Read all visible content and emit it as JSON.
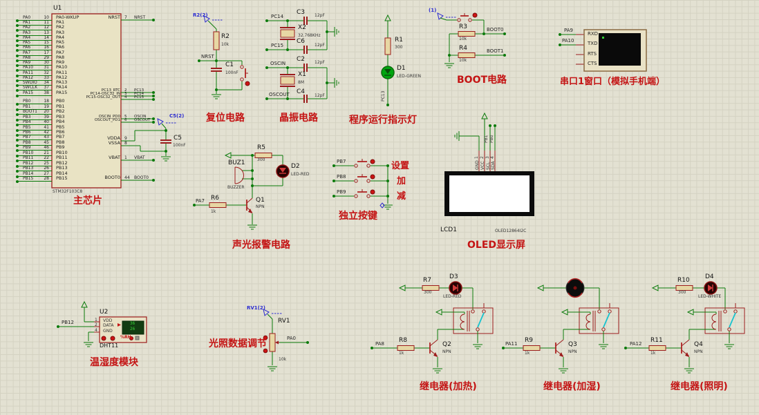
{
  "canvas": {
    "bg": "#e3e1d2",
    "grid": "#d4d2c2",
    "wire_color": "#0b7a0b",
    "part_color": "#9b1c1c",
    "accent_red": "#c41414",
    "accent_blue": "#2b2bd0"
  },
  "chip": {
    "ref": "U1",
    "part": "STM32F103C8",
    "caption": "主芯片",
    "pa_pins": [
      {
        "net": "PA0",
        "num": "10",
        "name": "PA0-WKUP"
      },
      {
        "net": "PA1",
        "num": "11",
        "name": "PA1"
      },
      {
        "net": "PA2",
        "num": "12",
        "name": "PA2"
      },
      {
        "net": "PA3",
        "num": "13",
        "name": "PA3"
      },
      {
        "net": "PA4",
        "num": "14",
        "name": "PA4"
      },
      {
        "net": "PA5",
        "num": "15",
        "name": "PA5"
      },
      {
        "net": "PA6",
        "num": "16",
        "name": "PA6"
      },
      {
        "net": "PA7",
        "num": "17",
        "name": "PA7"
      },
      {
        "net": "PA8",
        "num": "29",
        "name": "PA8"
      },
      {
        "net": "PA9",
        "num": "30",
        "name": "PA9"
      },
      {
        "net": "PA10",
        "num": "31",
        "name": "PA10"
      },
      {
        "net": "PA11",
        "num": "32",
        "name": "PA11"
      },
      {
        "net": "PA12",
        "num": "33",
        "name": "PA12"
      },
      {
        "net": "SWDIO",
        "num": "34",
        "name": "PA13"
      },
      {
        "net": "SWCLK",
        "num": "37",
        "name": "PA14"
      },
      {
        "net": "PA15",
        "num": "38",
        "name": "PA15"
      }
    ],
    "pb_pins": [
      {
        "net": "PB0",
        "num": "18",
        "name": "PB0"
      },
      {
        "net": "PB1",
        "num": "19",
        "name": "PB1"
      },
      {
        "net": "BOOT1",
        "num": "20",
        "name": "PB2"
      },
      {
        "net": "PB3",
        "num": "39",
        "name": "PB3"
      },
      {
        "net": "PB4",
        "num": "40",
        "name": "PB4"
      },
      {
        "net": "PB5",
        "num": "41",
        "name": "PB5"
      },
      {
        "net": "PB6",
        "num": "42",
        "name": "PB6"
      },
      {
        "net": "PB7",
        "num": "43",
        "name": "PB7"
      },
      {
        "net": "PB8",
        "num": "45",
        "name": "PB8"
      },
      {
        "net": "PB9",
        "num": "46",
        "name": "PB9"
      },
      {
        "net": "PB10",
        "num": "21",
        "name": "PB10"
      },
      {
        "net": "PB11",
        "num": "22",
        "name": "PB11"
      },
      {
        "net": "PB12",
        "num": "25",
        "name": "PB12"
      },
      {
        "net": "PB13",
        "num": "26",
        "name": "PB13"
      },
      {
        "net": "PB14",
        "num": "27",
        "name": "PB14"
      },
      {
        "net": "PB15",
        "num": "28",
        "name": "PB15"
      }
    ],
    "right_pins": [
      {
        "num": "7",
        "name": "NRST",
        "net": "NRST"
      },
      {
        "num": "2",
        "name": "PC13_RTC",
        "net": "PC13"
      },
      {
        "num": "3",
        "name": "PC14-OSC32_IN",
        "net": "PC14"
      },
      {
        "num": "4",
        "name": "PC15-OSC32_OUT",
        "net": "PC15"
      },
      {
        "num": "5",
        "name": "OSCIN_PD0",
        "net": "OSCIN"
      },
      {
        "num": "6",
        "name": "OSCOUT_PD1",
        "net": "OSCOUT"
      },
      {
        "num": "9",
        "name": "VDDA",
        "net": ""
      },
      {
        "num": "8",
        "name": "VSSA",
        "net": ""
      },
      {
        "num": "1",
        "name": "VBAT",
        "net": "VBAT"
      },
      {
        "num": "44",
        "name": "BOOT0",
        "net": "BOOT0"
      }
    ]
  },
  "reset": {
    "caption": "复位电路",
    "flag": "R2(2)",
    "r_ref": "R2",
    "r_val": "10k",
    "net": "NRST",
    "c_ref": "C1",
    "c_val": "100nF"
  },
  "crystal": {
    "caption": "晶振电路",
    "net_pc14": "PC14",
    "net_pc15": "PC15",
    "net_oscin": "OSCIN",
    "net_oscout": "OSCOUT",
    "c3": "C3",
    "c3_val": "12pF",
    "c6": "C6",
    "c6_val": "12pF",
    "c2": "C2",
    "c2_val": "12pF",
    "c4": "C4",
    "c4_val": "12pF",
    "x2": "X2",
    "x2_val": "32.768KHz",
    "x1": "X1",
    "x1_val": "8M"
  },
  "c5": {
    "flag": "C5(2)",
    "ref": "C5",
    "val": "100nF"
  },
  "runled": {
    "caption": "程序运行指示灯",
    "r_ref": "R1",
    "r_val": "300",
    "d_ref": "D1",
    "d_val": "LED-GREEN",
    "net": "PC13"
  },
  "boot": {
    "caption": "BOOT电路",
    "flag": "(1)",
    "r3_ref": "R3",
    "r3_val": "10k",
    "r4_ref": "R4",
    "r4_val": "10k",
    "net0": "BOOT0",
    "net1": "BOOT1"
  },
  "serial": {
    "caption": "串口1窗口（模拟手机端）",
    "net_rx": "PA9",
    "net_tx": "PA10",
    "pin_rxd": "RXD",
    "pin_txd": "TXD",
    "pin_rts": "RTS",
    "pin_cts": "CTS"
  },
  "alarm": {
    "caption": "声光报警电路",
    "buz_ref": "BUZ1",
    "buz_val": "BUZZER",
    "r5_ref": "R5",
    "r5_val": "300",
    "d2_ref": "D2",
    "d2_val": "LED-RED",
    "q_ref": "Q1",
    "q_val": "NPN",
    "r6_ref": "R6",
    "r6_val": "1k",
    "net": "PA7"
  },
  "keys": {
    "caption": "独立按键",
    "rows": [
      {
        "net": "PB7",
        "label": "设置"
      },
      {
        "net": "PB8",
        "label": "加"
      },
      {
        "net": "PB9",
        "label": "减"
      }
    ]
  },
  "oled": {
    "caption": "OLED显示屏",
    "ref": "LCD1",
    "part": "OLED12864I2C",
    "pins": [
      "GND",
      "VCC",
      "SCL",
      "SDA"
    ],
    "nums": [
      "1",
      "2",
      "3",
      "4"
    ],
    "net_scl": "PB1",
    "net_sda": "PB0"
  },
  "dht": {
    "caption": "温湿度模块",
    "ref": "U2",
    "part": "DHT11",
    "n1": "1",
    "n2": "2",
    "n4": "4",
    "pin1": "VDD",
    "pin2": "DATA",
    "pin4": "GND",
    "net": "PB12",
    "temp": "36",
    "hum": "26",
    "rh": "%RH"
  },
  "pot": {
    "caption": "光照数据调节",
    "flag": "RV1(2)",
    "ref": "RV1",
    "val": "10k",
    "net": "PA0"
  },
  "relay1": {
    "caption": "继电器(加热)",
    "r_ref": "R7",
    "r_val": "300",
    "d_ref": "D3",
    "d_val": "LED-RED",
    "rb_ref": "R8",
    "rb_val": "1k",
    "q_ref": "Q2",
    "q_val": "NPN",
    "net": "PA8"
  },
  "relay2": {
    "caption": "继电器(加湿)",
    "rb_ref": "R9",
    "rb_val": "1k",
    "q_ref": "Q3",
    "q_val": "NPN",
    "net": "PA11"
  },
  "relay3": {
    "caption": "继电器(照明)",
    "r_ref": "R10",
    "r_val": "300",
    "d_ref": "D4",
    "d_val": "LED-WHITE",
    "rb_ref": "R11",
    "rb_val": "1k",
    "q_ref": "Q4",
    "q_val": "NPN",
    "net": "PA12"
  }
}
